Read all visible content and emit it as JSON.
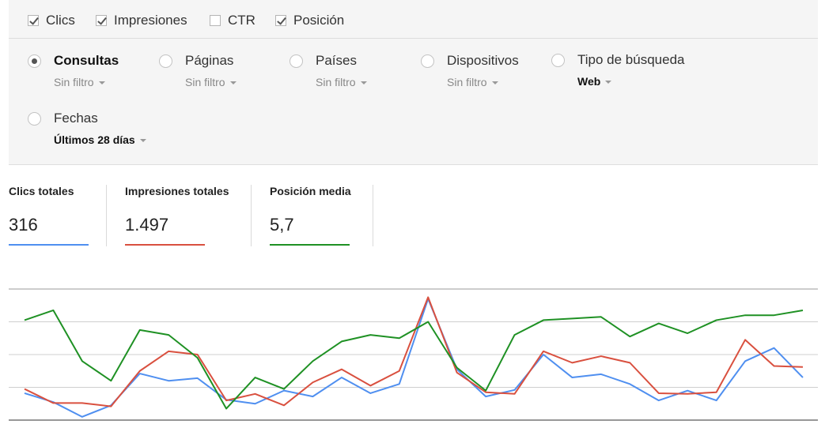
{
  "metrics": [
    {
      "label": "Clics",
      "checked": true
    },
    {
      "label": "Impresiones",
      "checked": true
    },
    {
      "label": "CTR",
      "checked": false
    },
    {
      "label": "Posición",
      "checked": true
    }
  ],
  "filters": [
    {
      "name": "Consultas",
      "value": "Sin filtro",
      "selected": true
    },
    {
      "name": "Páginas",
      "value": "Sin filtro",
      "selected": false
    },
    {
      "name": "Países",
      "value": "Sin filtro",
      "selected": false
    },
    {
      "name": "Dispositivos",
      "value": "Sin filtro",
      "selected": false
    },
    {
      "name": "Tipo de búsqueda",
      "value": "Web",
      "selected": false
    },
    {
      "name": "Fechas",
      "value": "Últimos 28 días",
      "selected": false
    }
  ],
  "totals": [
    {
      "label": "Clics totales",
      "value": "316",
      "color": "#4f8ff0"
    },
    {
      "label": "Impresiones totales",
      "value": "1.497",
      "color": "#d9503f"
    },
    {
      "label": "Posición media",
      "value": "5,7",
      "color": "#1f9124"
    }
  ],
  "chart_data": {
    "type": "line",
    "grid": true,
    "x": [
      1,
      2,
      3,
      4,
      5,
      6,
      7,
      8,
      9,
      10,
      11,
      12,
      13,
      14,
      15,
      16,
      17,
      18,
      19,
      20,
      21,
      22,
      23,
      24,
      25,
      26,
      27,
      28,
      29,
      30,
      31,
      32,
      33,
      34,
      35,
      36,
      37
    ],
    "ylim": [
      0,
      4
    ],
    "series": [
      {
        "color": "#4f8ff0",
        "values": [
          0.82,
          0.55,
          0.1,
          0.45,
          1.42,
          1.2,
          1.28,
          0.62,
          0.5,
          0.9,
          0.72,
          1.3,
          0.82,
          1.1,
          3.7,
          1.55,
          0.72,
          0.92,
          2.0,
          1.3,
          1.4,
          1.1,
          0.6,
          0.9,
          0.6,
          1.8,
          2.2,
          1.3
        ]
      },
      {
        "color": "#d9503f",
        "values": [
          0.95,
          0.52,
          0.52,
          0.42,
          1.5,
          2.1,
          2.0,
          0.6,
          0.8,
          0.45,
          1.15,
          1.55,
          1.05,
          1.5,
          3.75,
          1.45,
          0.85,
          0.8,
          2.1,
          1.75,
          1.95,
          1.75,
          0.82,
          0.8,
          0.85,
          2.45,
          1.65,
          1.62
        ]
      },
      {
        "color": "#1f9124",
        "values": [
          3.05,
          3.35,
          1.8,
          1.2,
          2.75,
          2.6,
          1.9,
          0.35,
          1.3,
          0.95,
          1.8,
          2.4,
          2.6,
          2.5,
          3.0,
          1.6,
          0.9,
          2.6,
          3.05,
          3.1,
          3.15,
          2.55,
          2.95,
          2.65,
          3.05,
          3.2,
          3.2,
          3.35
        ]
      }
    ]
  }
}
